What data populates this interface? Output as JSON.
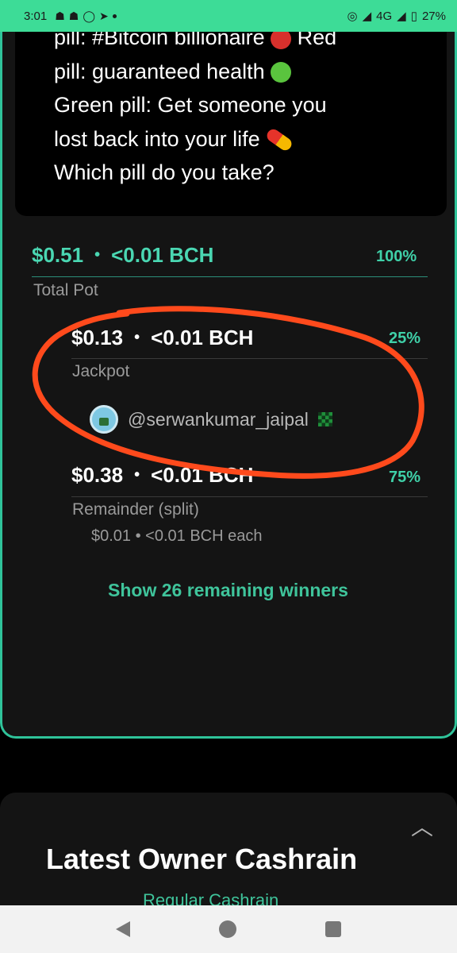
{
  "status_bar": {
    "time": "3:01",
    "left_icons": [
      "snapchat-icon",
      "snapchat-icon",
      "whatsapp-icon",
      "telegram-icon",
      "dot-icon"
    ],
    "network": "4G",
    "battery": "27%"
  },
  "post": {
    "lines": [
      "pill: #Bitcoin billionaire",
      "Red",
      "pill: guaranteed health",
      "Green pill: Get someone you",
      "lost back into your life",
      "Which pill do you take?"
    ],
    "emojis": [
      "red-circle-icon",
      "green-circle-icon",
      "pill-icon"
    ]
  },
  "pot": {
    "total": {
      "usd": "$0.51",
      "bullet": "•",
      "bch": "<0.01 BCH",
      "percent": "100%",
      "label": "Total Pot"
    },
    "jackpot": {
      "usd": "$0.13",
      "bullet": "•",
      "bch": "<0.01 BCH",
      "percent": "25%",
      "label": "Jackpot"
    },
    "winner": {
      "handle": "@serwankumar_jaipal"
    },
    "remainder": {
      "usd": "$0.38",
      "bullet": "•",
      "bch": "<0.01 BCH",
      "percent": "75%",
      "label": "Remainder (split)",
      "each": "$0.01 • <0.01 BCH each"
    },
    "show_more": "Show 26 remaining winners"
  },
  "latest": {
    "title": "Latest Owner Cashrain",
    "subtitle": "Regular Cashrain"
  },
  "colors": {
    "status_bar": "#3ddc97",
    "accent": "#3fd0a8",
    "annotation": "#ff4a1c"
  }
}
